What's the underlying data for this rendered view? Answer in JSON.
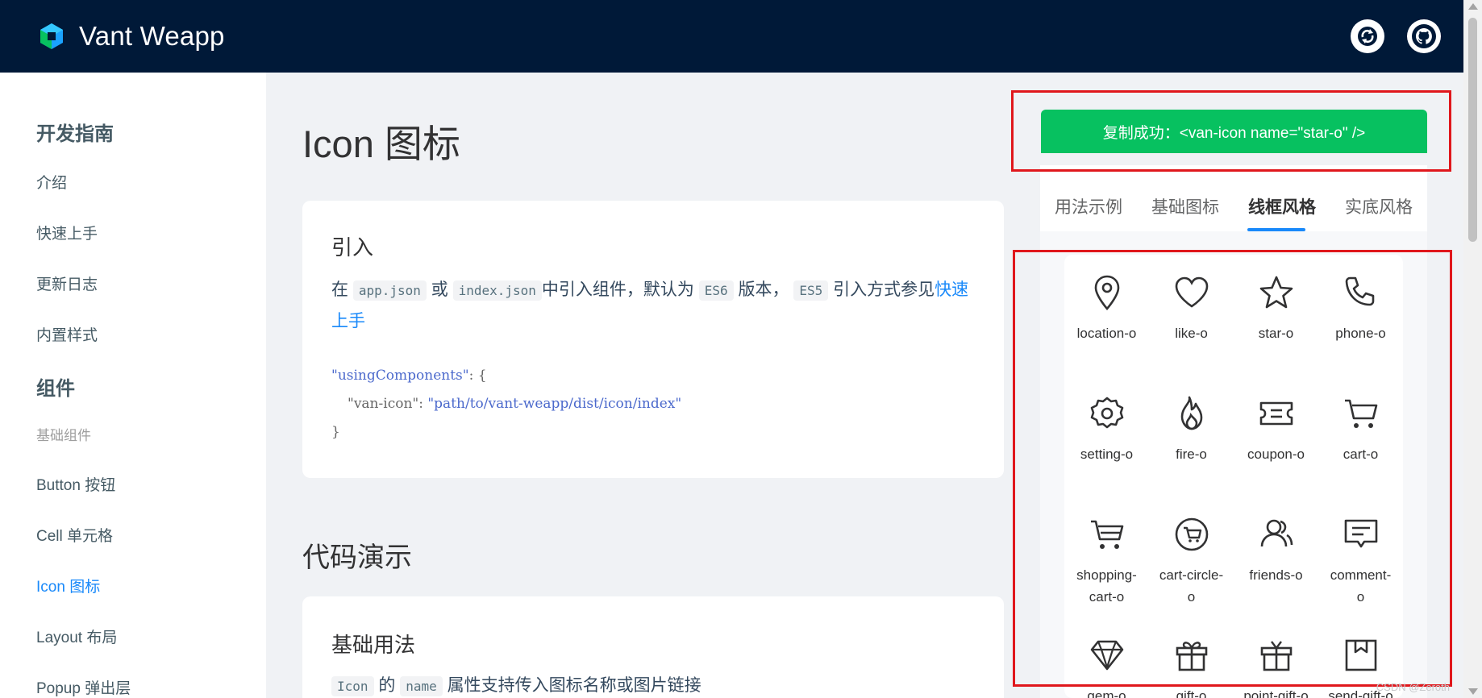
{
  "header": {
    "title": "Vant Weapp",
    "colors": {
      "bg": "#001938",
      "accent": "#1989fa"
    }
  },
  "sidebar": {
    "group_guide": "开发指南",
    "items_guide": [
      "介绍",
      "快速上手",
      "更新日志",
      "内置样式"
    ],
    "group_components": "组件",
    "sub_basic": "基础组件",
    "items_components": [
      "Button 按钮",
      "Cell 单元格",
      "Icon 图标",
      "Layout 布局",
      "Popup 弹出层"
    ],
    "active_item": "Icon 图标"
  },
  "main": {
    "title": "Icon 图标",
    "intro_card": {
      "title": "引入",
      "p1": "在",
      "code1": "app.json",
      "p2": "或",
      "code2": "index.json",
      "p3": "中引入组件，默认为",
      "code3": "ES6",
      "p4": "版本，",
      "code4": "ES5",
      "p5": "引入方式参见",
      "link": "快速上手",
      "code_key1": "\"usingComponents\"",
      "code_brace_open": ": {",
      "code_key2": "\"van-icon\"",
      "code_sep": ": ",
      "code_val2": "\"path/to/vant-weapp/dist/icon/index\"",
      "code_brace_close": "}"
    },
    "section_title": "代码演示",
    "demo_card": {
      "title": "基础用法",
      "code1": "Icon",
      "t1": "的",
      "code2": "name",
      "t2": "属性支持传入图标名称或图片链接"
    }
  },
  "simulator": {
    "toast": "复制成功：<van-icon name=\"star-o\" />",
    "tabs": [
      "用法示例",
      "基础图标",
      "线框风格",
      "实底风格"
    ],
    "active_tab": "线框风格",
    "icons": [
      {
        "name": "location-o",
        "label": "location-o"
      },
      {
        "name": "like-o",
        "label": "like-o"
      },
      {
        "name": "star-o",
        "label": "star-o"
      },
      {
        "name": "phone-o",
        "label": "phone-o"
      },
      {
        "name": "setting-o",
        "label": "setting-o"
      },
      {
        "name": "fire-o",
        "label": "fire-o"
      },
      {
        "name": "coupon-o",
        "label": "coupon-o"
      },
      {
        "name": "cart-o",
        "label": "cart-o"
      },
      {
        "name": "shopping-cart-o",
        "label1": "shopping-",
        "label2": "cart-o"
      },
      {
        "name": "cart-circle-o",
        "label1": "cart-circle-",
        "label2": "o"
      },
      {
        "name": "friends-o",
        "label": "friends-o"
      },
      {
        "name": "comment-o",
        "label1": "comment-",
        "label2": "o"
      },
      {
        "name": "gem-o",
        "label": "gem-o"
      },
      {
        "name": "gift-o",
        "label": "gift-o"
      },
      {
        "name": "point-gift-o",
        "label": "point-gift-o"
      },
      {
        "name": "send-gift-o",
        "label": "send-gift-o"
      }
    ]
  },
  "watermark": "CSDN @Zeroth"
}
